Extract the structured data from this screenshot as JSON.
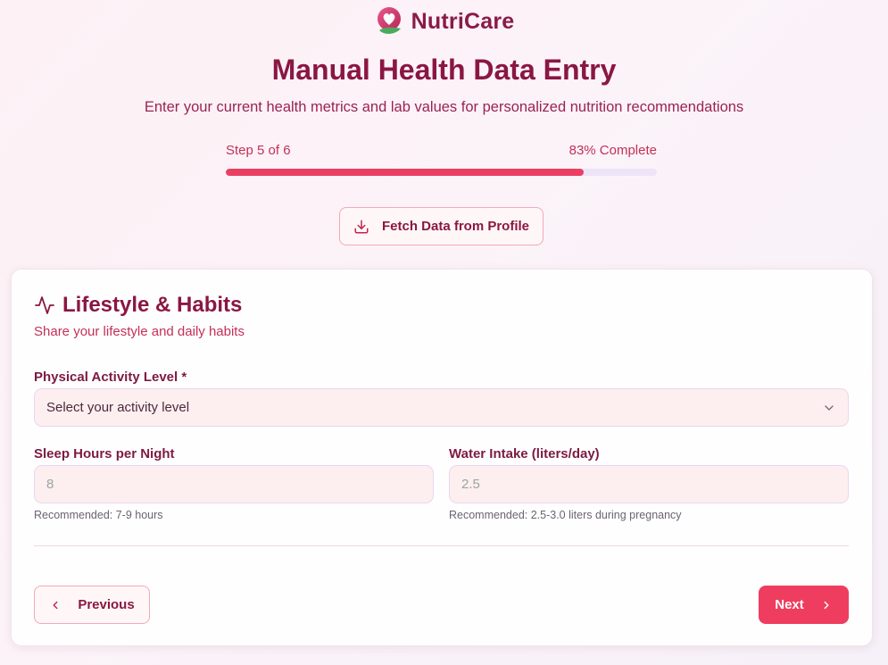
{
  "brand": {
    "name": "NutriCare",
    "logo_icon": "heart-leaf-logo"
  },
  "header": {
    "title": "Manual Health Data Entry",
    "subtitle": "Enter your current health metrics and lab values for personalized nutrition recommendations"
  },
  "progress": {
    "step_label": "Step 5 of 6",
    "percent_label": "83% Complete",
    "fraction": 0.83
  },
  "fetch": {
    "label": "Fetch Data from Profile",
    "icon": "download-icon"
  },
  "section": {
    "icon": "activity-icon",
    "title": "Lifestyle & Habits",
    "subtitle": "Share your lifestyle and daily habits"
  },
  "fields": {
    "activity": {
      "label": "Physical Activity Level *",
      "value": "Select your activity level",
      "icon": "chevron-down-icon"
    },
    "sleep": {
      "label": "Sleep Hours per Night",
      "placeholder": "8",
      "hint": "Recommended: 7-9 hours"
    },
    "water": {
      "label": "Water Intake (liters/day)",
      "placeholder": "2.5",
      "hint": "Recommended: 2.5-3.0 liters during pregnancy"
    }
  },
  "nav": {
    "previous_label": "Previous",
    "next_label": "Next"
  },
  "colors": {
    "accent": "#ee3d5e",
    "brand": "#8a1742",
    "progress_track": "#ede4f8"
  }
}
